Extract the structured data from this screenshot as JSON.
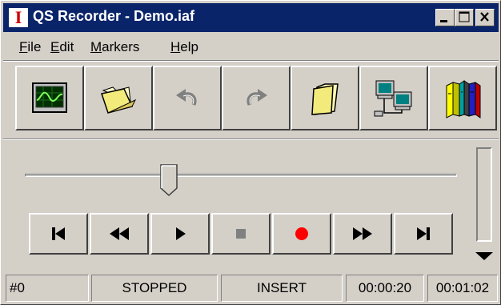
{
  "window": {
    "title": "QS Recorder - Demo.iaf",
    "app_icon_letter": "I"
  },
  "menu": {
    "items": [
      {
        "access_key": "F",
        "rest": "ile"
      },
      {
        "access_key": "E",
        "rest": "dit"
      },
      {
        "access_key": "M",
        "rest": "arkers"
      },
      {
        "access_key": "H",
        "rest": "elp"
      }
    ]
  },
  "toolbar": {
    "buttons": [
      {
        "icon": "waveform-monitor-icon",
        "enabled": true
      },
      {
        "icon": "open-folder-icon",
        "enabled": true
      },
      {
        "icon": "undo-icon",
        "enabled": false
      },
      {
        "icon": "redo-icon",
        "enabled": false
      },
      {
        "icon": "closed-folder-icon",
        "enabled": true
      },
      {
        "icon": "network-computers-icon",
        "enabled": true
      },
      {
        "icon": "books-library-icon",
        "enabled": true
      }
    ]
  },
  "position_slider": {
    "value_fraction": 0.32
  },
  "volume_slider": {
    "value_fraction": 1.0
  },
  "transport": {
    "buttons": [
      {
        "icon": "skip-to-start-icon",
        "enabled": true
      },
      {
        "icon": "rewind-icon",
        "enabled": true
      },
      {
        "icon": "play-icon",
        "enabled": true
      },
      {
        "icon": "stop-icon",
        "enabled": false
      },
      {
        "icon": "record-icon",
        "enabled": true,
        "color": "#ff0000"
      },
      {
        "icon": "fast-forward-icon",
        "enabled": true
      },
      {
        "icon": "skip-to-end-icon",
        "enabled": true
      }
    ]
  },
  "status": {
    "marker": "#0",
    "state": "STOPPED",
    "mode": "INSERT",
    "position_time": "00:00:20",
    "total_time": "00:01:02"
  },
  "colors": {
    "titlebar": "#0a246a",
    "face": "#d4d0c8",
    "record": "#ff0000",
    "icon_letter": "#cc0000"
  }
}
